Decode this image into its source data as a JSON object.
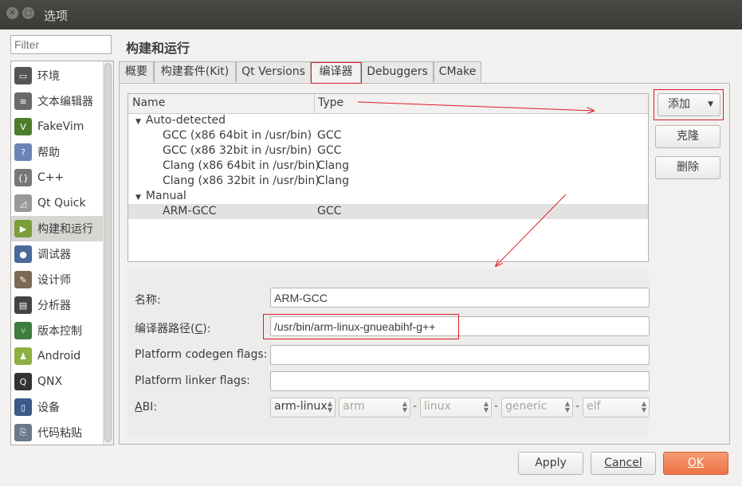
{
  "window": {
    "title": "选项"
  },
  "filter": {
    "placeholder": "Filter"
  },
  "sidebar": {
    "items": [
      {
        "label": "环境",
        "icon": "monitor-icon",
        "color": "#555"
      },
      {
        "label": "文本编辑器",
        "icon": "text-editor-icon",
        "color": "#6a6a6a"
      },
      {
        "label": "FakeVim",
        "icon": "fakevim-icon",
        "color": "#4b7d2a"
      },
      {
        "label": "帮助",
        "icon": "help-icon",
        "color": "#6b85b8"
      },
      {
        "label": "C++",
        "icon": "braces-icon",
        "color": "#777"
      },
      {
        "label": "Qt Quick",
        "icon": "qt-quick-icon",
        "color": "#999"
      },
      {
        "label": "构建和运行",
        "icon": "build-run-icon",
        "color": "#7b9d3a"
      },
      {
        "label": "调试器",
        "icon": "debugger-icon",
        "color": "#4a6a9a"
      },
      {
        "label": "设计师",
        "icon": "designer-icon",
        "color": "#7a6a55"
      },
      {
        "label": "分析器",
        "icon": "analyzer-icon",
        "color": "#444"
      },
      {
        "label": "版本控制",
        "icon": "version-control-icon",
        "color": "#3d7d3d"
      },
      {
        "label": "Android",
        "icon": "android-icon",
        "color": "#8cb043"
      },
      {
        "label": "QNX",
        "icon": "qnx-icon",
        "color": "#333"
      },
      {
        "label": "设备",
        "icon": "device-icon",
        "color": "#3a5a8a"
      },
      {
        "label": "代码粘贴",
        "icon": "code-paste-icon",
        "color": "#6a7a8a"
      }
    ],
    "selected_index": 6
  },
  "page": {
    "title": "构建和运行"
  },
  "tabs": [
    {
      "label": "概要"
    },
    {
      "label": "构建套件(Kit)"
    },
    {
      "label": "Qt Versions"
    },
    {
      "label": "编译器"
    },
    {
      "label": "Debuggers"
    },
    {
      "label": "CMake"
    }
  ],
  "active_tab_index": 3,
  "tree": {
    "col_name": "Name",
    "col_type": "Type",
    "groups": [
      {
        "label": "Auto-detected",
        "items": [
          {
            "name": "GCC (x86 64bit in /usr/bin)",
            "type": "GCC"
          },
          {
            "name": "GCC (x86 32bit in /usr/bin)",
            "type": "GCC"
          },
          {
            "name": "Clang (x86 64bit in /usr/bin)",
            "type": "Clang"
          },
          {
            "name": "Clang (x86 32bit in /usr/bin)",
            "type": "Clang"
          }
        ]
      },
      {
        "label": "Manual",
        "items": [
          {
            "name": "ARM-GCC",
            "type": "GCC"
          }
        ]
      }
    ]
  },
  "buttons": {
    "add": "添加",
    "clone": "克隆",
    "remove": "删除",
    "apply": "Apply",
    "cancel": "Cancel",
    "ok": "OK"
  },
  "form": {
    "name_label": "名称:",
    "name_value": "ARM-GCC",
    "path_label_pre": "编译器路径(",
    "path_label_key": "C",
    "path_label_post": "):",
    "path_value": "/usr/bin/arm-linux-gnueabihf-g++",
    "codegen_label": "Platform codegen flags:",
    "codegen_value": "",
    "linker_label": "Platform linker flags:",
    "linker_value": "",
    "abi_label_key": "A",
    "abi_label_post": "BI:",
    "abi": [
      "arm-linux",
      "arm",
      "linux",
      "generic",
      "elf"
    ],
    "abi_sep": "-"
  },
  "colors": {
    "highlight": "#e01b24",
    "accent": "#ed7446"
  }
}
